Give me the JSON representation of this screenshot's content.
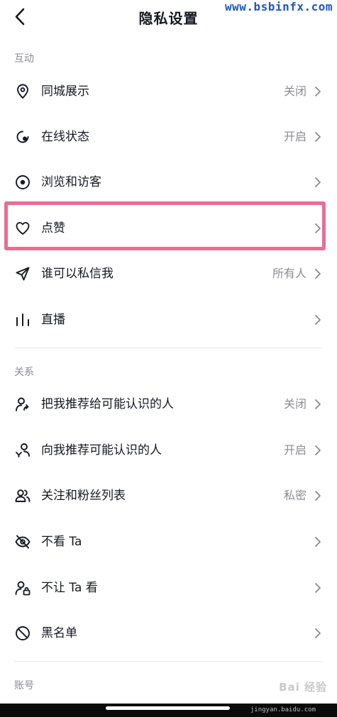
{
  "header": {
    "title": "隐私设置"
  },
  "watermark": {
    "site": "www.bsbinfx.com",
    "baidu": "Bai 经验",
    "baidu_url": "jingyan.baidu.com"
  },
  "sections": {
    "interact": "互动",
    "relation": "关系",
    "account": "账号"
  },
  "rows": {
    "nearby": {
      "label": "同城展示",
      "value": "关闭",
      "icon": "location-pin-icon"
    },
    "online": {
      "label": "在线状态",
      "value": "开启",
      "icon": "online-status-icon"
    },
    "browse": {
      "label": "浏览和访客",
      "value": "",
      "icon": "eye-icon"
    },
    "likes": {
      "label": "点赞",
      "value": "",
      "icon": "heart-icon"
    },
    "message": {
      "label": "谁可以私信我",
      "value": "所有人",
      "icon": "paper-plane-icon"
    },
    "live": {
      "label": "直播",
      "value": "",
      "icon": "live-bars-icon"
    },
    "recommend_me": {
      "label": "把我推荐给可能认识的人",
      "value": "关闭",
      "icon": "user-share-icon"
    },
    "recommend_to_me": {
      "label": "向我推荐可能认识的人",
      "value": "开启",
      "icon": "user-recommend-icon"
    },
    "follow_list": {
      "label": "关注和粉丝列表",
      "value": "私密",
      "icon": "users-icon"
    },
    "hide_ta": {
      "label": "不看 Ta",
      "value": "",
      "icon": "eye-off-icon"
    },
    "block_ta": {
      "label": "不让 Ta 看",
      "value": "",
      "icon": "user-lock-icon"
    },
    "blacklist": {
      "label": "黑名单",
      "value": "",
      "icon": "block-icon"
    }
  },
  "colors": {
    "highlight": "#e96d92",
    "text": "#161823",
    "muted": "#8a8b91",
    "watermark": "#1e56c6"
  }
}
